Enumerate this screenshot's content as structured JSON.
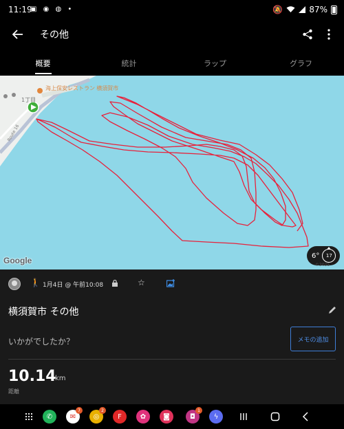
{
  "status_bar": {
    "time": "11:19",
    "left_icons": "▣ ◉ ◍ •",
    "battery": "87%"
  },
  "app_bar": {
    "title": "その他"
  },
  "tabs": [
    {
      "label": "概要",
      "active": true
    },
    {
      "label": "統計",
      "active": false
    },
    {
      "label": "ラップ",
      "active": false
    },
    {
      "label": "グラフ",
      "active": false
    }
  ],
  "map": {
    "attribution": "Google",
    "poi_label": "海上保安レストラン 横須賀市",
    "district_label": "1丁目",
    "road_label": "Route 16",
    "copyright": "©2025",
    "weather_temp": "6°",
    "wind_value": "17",
    "route_color": "#e8203a",
    "water_color": "#8fd7e8",
    "start_marker_color": "#3fae3a"
  },
  "activity": {
    "date": "1月4日 @ 午前10:08",
    "title": "横須賀市 その他",
    "feel_prompt": "いかがでしたか？",
    "memo_button": "メモの追加"
  },
  "stats": {
    "distance_value": "10.14",
    "distance_unit": "km",
    "distance_label": "距離"
  },
  "nav_bar": {
    "apps": [
      {
        "name": "phone",
        "color": "#21b35a",
        "glyph": "✆",
        "badge": ""
      },
      {
        "name": "mail",
        "color": "#ffffff",
        "glyph": "✉",
        "badge": "7"
      },
      {
        "name": "chrome",
        "color": "#e8b000",
        "glyph": "◎",
        "badge": "2"
      },
      {
        "name": "flipboard",
        "color": "#e12828",
        "glyph": "F",
        "badge": ""
      },
      {
        "name": "flower",
        "color": "#e0327c",
        "glyph": "✿",
        "badge": ""
      },
      {
        "name": "camera",
        "color": "#e0325b",
        "glyph": "◙",
        "badge": ""
      },
      {
        "name": "instagram",
        "color": "#c13584",
        "glyph": "◘",
        "badge": "1"
      },
      {
        "name": "messenger",
        "color": "#5b6cf0",
        "glyph": "ϟ",
        "badge": ""
      }
    ]
  }
}
